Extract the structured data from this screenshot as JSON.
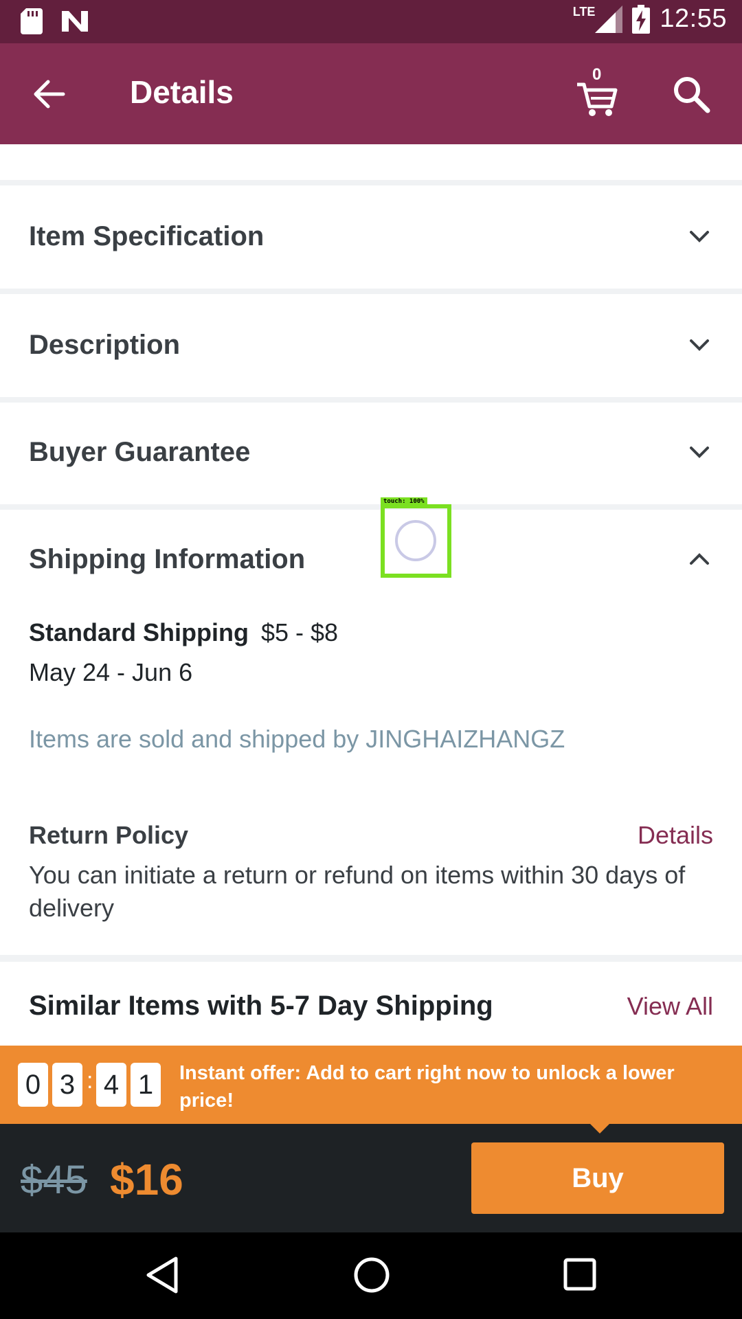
{
  "status_bar": {
    "time": "12:55",
    "network": "LTE",
    "icons": [
      "sd-card-icon",
      "n-notification-icon",
      "signal-icon",
      "battery-charging-icon"
    ]
  },
  "app_bar": {
    "title": "Details",
    "cart_count": "0",
    "icons": [
      "back-arrow-icon",
      "cart-icon",
      "search-icon"
    ]
  },
  "sections": [
    {
      "label": "Item Specification",
      "expanded": false
    },
    {
      "label": "Description",
      "expanded": false
    },
    {
      "label": "Buyer Guarantee",
      "expanded": false
    },
    {
      "label": "Shipping Information",
      "expanded": true
    }
  ],
  "shipping": {
    "method": "Standard Shipping",
    "price_range": "$5 - $8",
    "date_range": "May 24 - Jun 6",
    "seller_note": "Items are sold and shipped by JINGHAIZHANGZ"
  },
  "return_policy": {
    "title": "Return Policy",
    "details_link": "Details",
    "text": "You can initiate a return or refund on items within 30 days of delivery"
  },
  "similar": {
    "title": "Similar Items with 5-7 Day Shipping",
    "view_all": "View All"
  },
  "touch_overlay": {
    "label": "touch: 100%"
  },
  "offer": {
    "timer_digits": [
      "0",
      "3",
      "4",
      "1"
    ],
    "separator": ":",
    "text": "Instant offer: Add to cart right now to unlock a lower price!"
  },
  "price": {
    "original": "$45",
    "current": "$16",
    "buy_label": "Buy"
  },
  "colors": {
    "status_bar": "#621f3d",
    "app_bar": "#852d52",
    "accent": "#ee8b30",
    "bottom_bar": "#1e2225",
    "muted_text": "#7b96a5"
  }
}
